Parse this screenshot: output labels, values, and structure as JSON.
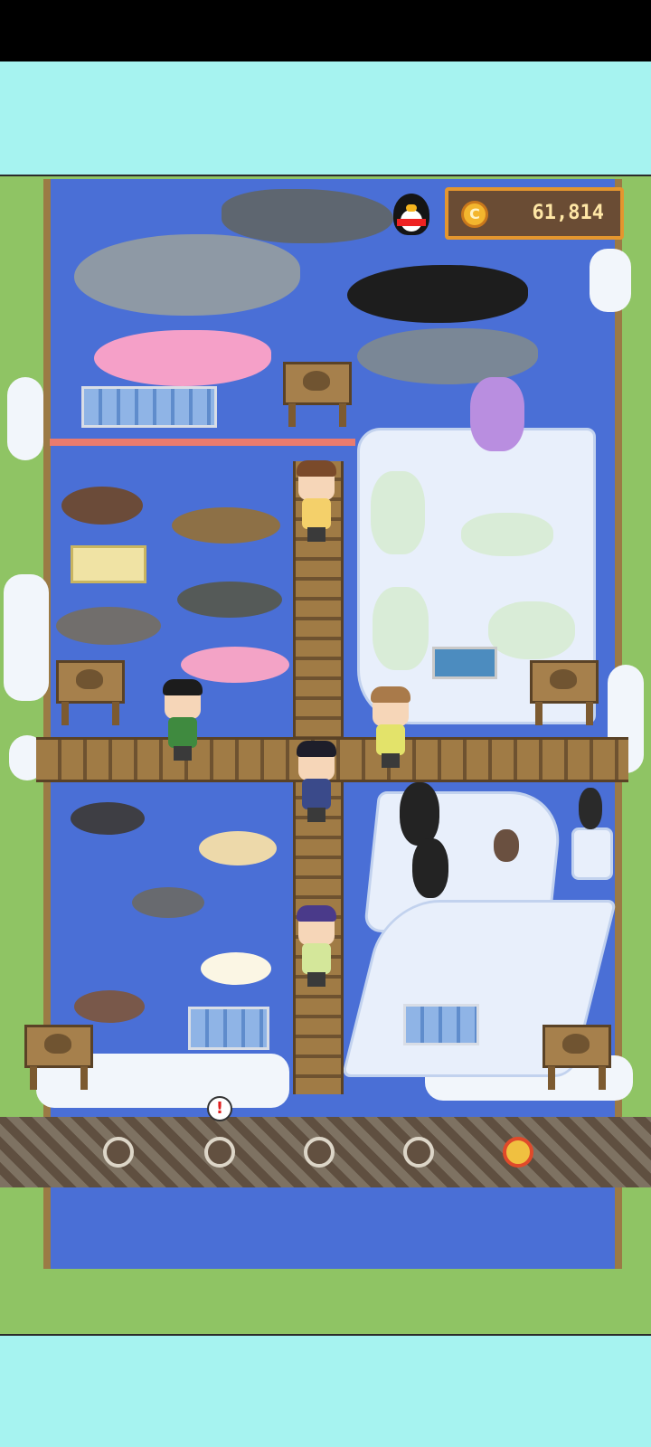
{
  "hud": {
    "coin_symbol": "C",
    "coin_count": "61,814",
    "alert_mark": "!"
  },
  "icons": {
    "qq": "qq-penguin-icon",
    "coin": "coin-icon"
  },
  "colors": {
    "water": "#4a6fd6",
    "grass": "#8fc464",
    "background": "#a6f3f0",
    "coin_border": "#e4962e"
  }
}
